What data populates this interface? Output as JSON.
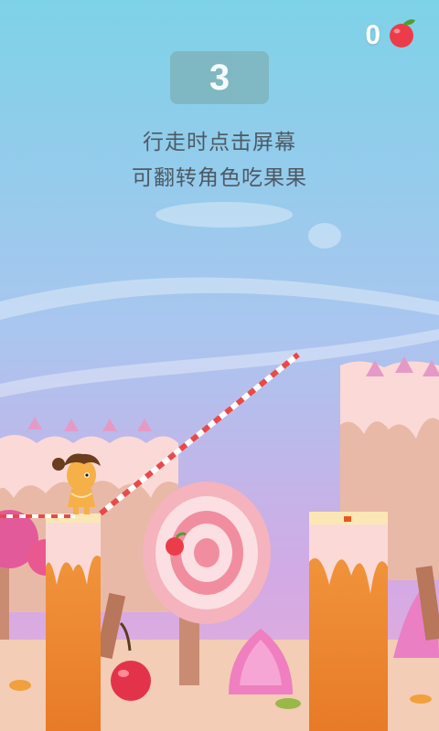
{
  "hud": {
    "fruit_count": "0",
    "fruit_icon": "apple-icon"
  },
  "level": {
    "countdown": "3"
  },
  "instructions": {
    "line1": "行走时点击屏幕",
    "line2": "可翻转角色吃果果"
  },
  "colors": {
    "sky_top": "#7ed2e8",
    "sky_bottom": "#d9a8e0",
    "platform_orange": "#ef8a34",
    "rope_red": "#e84a4a",
    "apple_red": "#ec3c4a"
  }
}
